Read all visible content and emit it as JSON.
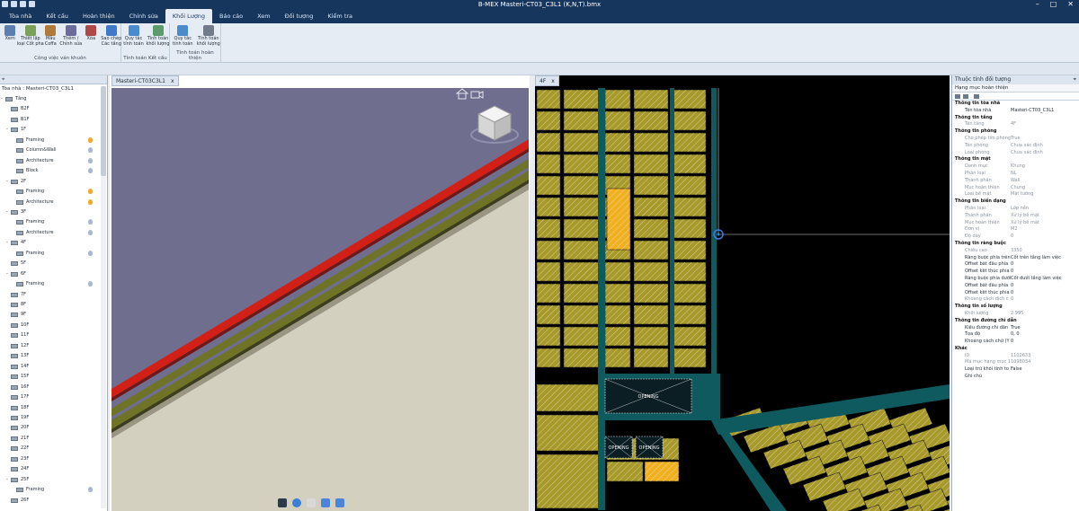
{
  "app": {
    "title": "B-MEX Masteri-CT03_C3L1 (K,N,T).bmx"
  },
  "ribbon_tabs": [
    "Tòa nhà",
    "Kết cấu",
    "Hoàn thiện",
    "Chỉnh sửa",
    "Khối Lượng",
    "Báo cáo",
    "Xem",
    "Đối tượng",
    "Kiểm tra"
  ],
  "ribbon_active": 4,
  "ribbon_groups": [
    {
      "label": "Công việc ván khuôn",
      "buttons": [
        {
          "label": "Xem",
          "icon": "view-icon"
        },
        {
          "label": "Thiết lập\nloại Cốt pha",
          "icon": "formwork-setup-icon"
        },
        {
          "label": "Mẫu\nCoffa",
          "icon": "formwork-template-icon"
        },
        {
          "label": "Thêm /\nChỉnh sửa",
          "icon": "add-edit-icon"
        },
        {
          "label": "Xóa",
          "icon": "delete-icon"
        },
        {
          "label": "Sao chép\nCác tầng",
          "icon": "copy-floors-icon"
        }
      ]
    },
    {
      "label": "Tính toán Kết cấu",
      "buttons": [
        {
          "label": "Quy tắc\ntính toán",
          "icon": "calc-rules-icon"
        },
        {
          "label": "Tính toán\nkhối lượng",
          "icon": "calc-volume-icon"
        }
      ]
    },
    {
      "label": "Tính toán hoàn thiện",
      "buttons": [
        {
          "label": "Quy tắc\ntính toán",
          "icon": "calc-rules-icon"
        },
        {
          "label": "Tính toán\nkhối lượng",
          "icon": "gear-icon"
        }
      ]
    }
  ],
  "tree": {
    "root": "Tòa nhà : Masteri-CT03_C3L1",
    "rows": [
      {
        "label": "Tầng",
        "level": 0,
        "toggle": "-"
      },
      {
        "label": "B2F",
        "level": 1,
        "toggle": ""
      },
      {
        "label": "B1F",
        "level": 1,
        "toggle": ""
      },
      {
        "label": "1F",
        "level": 1,
        "toggle": "-"
      },
      {
        "label": "Framing",
        "level": 2,
        "toggle": "",
        "bulb": "#f0a830"
      },
      {
        "label": "Column&Wall",
        "level": 2,
        "toggle": "",
        "bulb": "#a9b8cf"
      },
      {
        "label": "Architecture",
        "level": 2,
        "toggle": "",
        "bulb": "#a9b8cf"
      },
      {
        "label": "Block",
        "level": 2,
        "toggle": "",
        "bulb": "#a9b8cf"
      },
      {
        "label": "2F",
        "level": 1,
        "toggle": "-"
      },
      {
        "label": "Framing",
        "level": 2,
        "toggle": "",
        "bulb": "#f0a830"
      },
      {
        "label": "Architecture",
        "level": 2,
        "toggle": "",
        "bulb": "#f0a830"
      },
      {
        "label": "3F",
        "level": 1,
        "toggle": "-"
      },
      {
        "label": "Framing",
        "level": 2,
        "toggle": "",
        "bulb": "#a9b8cf"
      },
      {
        "label": "Architecture",
        "level": 2,
        "toggle": "",
        "bulb": "#a9b8cf"
      },
      {
        "label": "4F",
        "level": 1,
        "toggle": "-"
      },
      {
        "label": "Framing",
        "level": 2,
        "toggle": "",
        "bulb": "#a9b8cf"
      },
      {
        "label": "5F",
        "level": 1,
        "toggle": ""
      },
      {
        "label": "6F",
        "level": 1,
        "toggle": "-"
      },
      {
        "label": "Framing",
        "level": 2,
        "toggle": "",
        "bulb": "#a9b8cf"
      },
      {
        "label": "7F",
        "level": 1,
        "toggle": ""
      },
      {
        "label": "8F",
        "level": 1,
        "toggle": ""
      },
      {
        "label": "9F",
        "level": 1,
        "toggle": ""
      },
      {
        "label": "10F",
        "level": 1,
        "toggle": ""
      },
      {
        "label": "11F",
        "level": 1,
        "toggle": ""
      },
      {
        "label": "12F",
        "level": 1,
        "toggle": ""
      },
      {
        "label": "13F",
        "level": 1,
        "toggle": ""
      },
      {
        "label": "14F",
        "level": 1,
        "toggle": ""
      },
      {
        "label": "15F",
        "level": 1,
        "toggle": ""
      },
      {
        "label": "16F",
        "level": 1,
        "toggle": ""
      },
      {
        "label": "17F",
        "level": 1,
        "toggle": ""
      },
      {
        "label": "18F",
        "level": 1,
        "toggle": ""
      },
      {
        "label": "19F",
        "level": 1,
        "toggle": ""
      },
      {
        "label": "20F",
        "level": 1,
        "toggle": ""
      },
      {
        "label": "21F",
        "level": 1,
        "toggle": ""
      },
      {
        "label": "22F",
        "level": 1,
        "toggle": ""
      },
      {
        "label": "23F",
        "level": 1,
        "toggle": ""
      },
      {
        "label": "24F",
        "level": 1,
        "toggle": ""
      },
      {
        "label": "25F",
        "level": 1,
        "toggle": "-"
      },
      {
        "label": "Framing",
        "level": 2,
        "toggle": "",
        "bulb": "#a9b8cf"
      },
      {
        "label": "26F",
        "level": 1,
        "toggle": ""
      }
    ]
  },
  "view3d": {
    "tab": "Masteri-CT03C3L1",
    "close": "x",
    "colors": {
      "sky": "#6f6e8e",
      "ground": "#d4d0bf",
      "slab": "#d22016",
      "beam": "#6f7326"
    }
  },
  "view2d": {
    "tab": "4F",
    "close": "x",
    "colors": {
      "cell": "#a89a2a",
      "wall": "#0e5a5e",
      "highlight": "#f0b020",
      "bg": "#000000"
    },
    "opening_label": "OPENING"
  },
  "properties": {
    "title": "Thuộc tính đối tượng",
    "category": "Hạng mục hoàn thiện",
    "rows": [
      {
        "k": "Thông tin tòa nhà",
        "sec": true
      },
      {
        "k": "Tên tòa nhà",
        "v": "Masteri-CT03_C3L1"
      },
      {
        "k": "Thông tin tầng",
        "sec": true
      },
      {
        "k": "Tên tầng",
        "v": "4F",
        "grey": true
      },
      {
        "k": "Thông tin phòng",
        "sec": true
      },
      {
        "k": "Cho phép tìm phòng",
        "v": "True",
        "grey": true
      },
      {
        "k": "Tên phòng",
        "v": "Chưa xác định",
        "grey": true
      },
      {
        "k": "Loại phòng",
        "v": "Chưa xác định",
        "grey": true
      },
      {
        "k": "Thông tin mặt",
        "sec": true
      },
      {
        "k": "Danh mục",
        "v": "Khung",
        "grey": true
      },
      {
        "k": "Phân loại",
        "v": "NL",
        "grey": true
      },
      {
        "k": "Thành phần",
        "v": "Wall",
        "grey": true
      },
      {
        "k": "Mục hoàn thiện",
        "v": "Chung",
        "grey": true
      },
      {
        "k": "Loại bề mặt",
        "v": "Mặt tường",
        "grey": true
      },
      {
        "k": "Thông tin biến dạng",
        "sec": true
      },
      {
        "k": "Phân loại",
        "v": "Lớp nền",
        "grey": true
      },
      {
        "k": "Thành phần",
        "v": "Xử lý bề mặt",
        "grey": true
      },
      {
        "k": "Mục hoàn thiện",
        "v": "Xử lý bề mặt",
        "grey": true
      },
      {
        "k": "Đơn vị",
        "v": "M2",
        "grey": true
      },
      {
        "k": "Độ dày",
        "v": "0",
        "grey": true
      },
      {
        "k": "Thông tin ràng buộc",
        "sec": true
      },
      {
        "k": "Chiều cao",
        "v": "3350",
        "grey": true
      },
      {
        "k": "Ràng buộc phía trên",
        "v": "Cốt trên tầng làm việc"
      },
      {
        "k": "Offset bắt đầu phía",
        "v": "0"
      },
      {
        "k": "Offset kết thúc phía",
        "v": "0"
      },
      {
        "k": "Ràng buộc phía dưới",
        "v": "Cốt dưới tầng làm việc"
      },
      {
        "k": "Offset bắt đầu phía",
        "v": "0"
      },
      {
        "k": "Offset kết thúc phía",
        "v": "0"
      },
      {
        "k": "Khoảng cách dịch c",
        "v": "0",
        "grey": true
      },
      {
        "k": "Thông tin số lượng",
        "sec": true
      },
      {
        "k": "Khối lượng",
        "v": "2.995",
        "grey": true
      },
      {
        "k": "Thông tin đường chỉ dẫn",
        "sec": true
      },
      {
        "k": "Kiểu đường chỉ dẫn",
        "v": "True"
      },
      {
        "k": "Tọa độ",
        "v": "0, 0"
      },
      {
        "k": "Khoảng cách chữ (Y",
        "v": "0"
      },
      {
        "k": "Khác",
        "sec": true
      },
      {
        "k": "ID",
        "v": "1102633",
        "grey": true
      },
      {
        "k": "Mã mục hạng mục 1",
        "v": "1098034",
        "grey": true
      },
      {
        "k": "Loại trừ khỏi tính to",
        "v": "False"
      },
      {
        "k": "Ghi chú",
        "v": ""
      }
    ]
  },
  "icons": {
    "home": "home-icon",
    "camera": "camera-icon",
    "cube": "view-cube-icon"
  }
}
